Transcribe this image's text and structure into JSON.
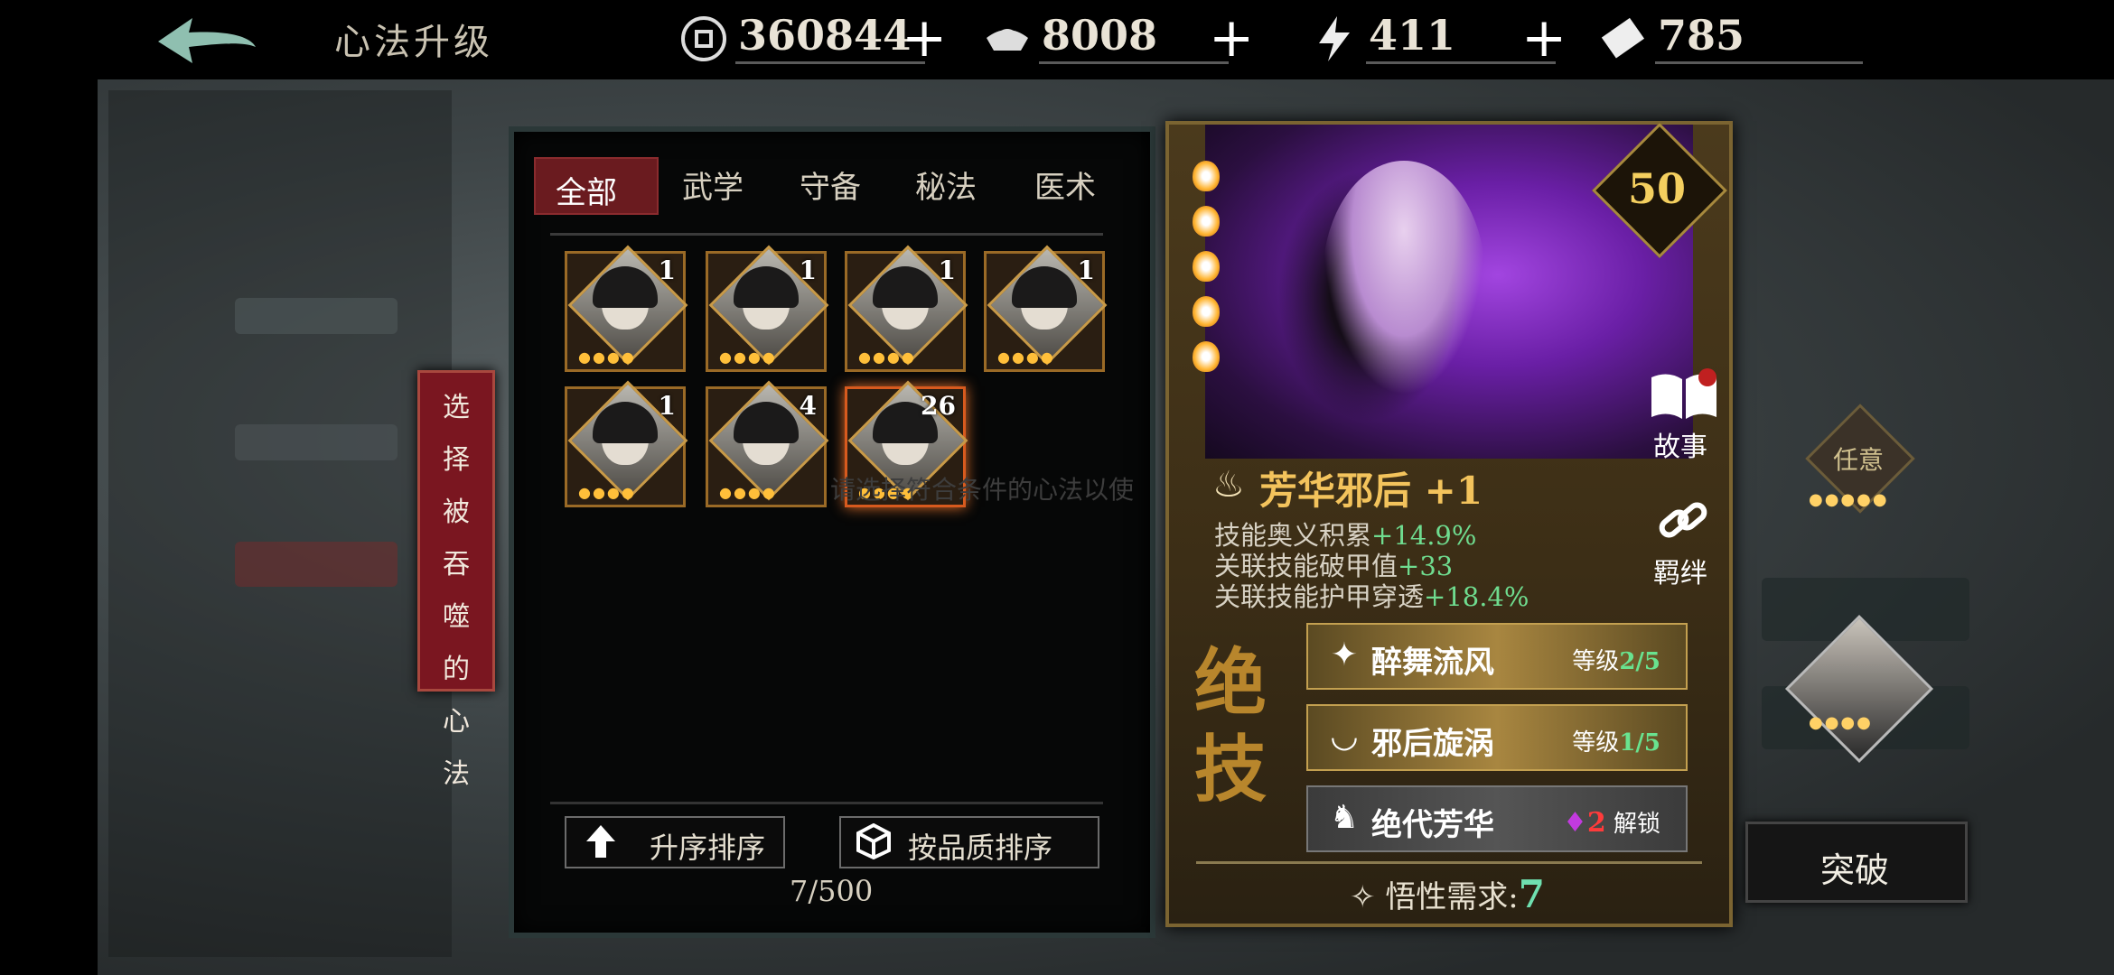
{
  "header": {
    "title": "心法升级",
    "resources": [
      {
        "icon": "coin-icon",
        "value": "360844"
      },
      {
        "icon": "silver-ingot-icon",
        "value": "8008"
      },
      {
        "icon": "lightning-icon",
        "value": "411"
      },
      {
        "icon": "ticket-icon",
        "value": "785"
      }
    ],
    "plus": "+"
  },
  "select_tag": [
    "选",
    "择",
    "被",
    "吞",
    "噬",
    "的",
    "心",
    "法"
  ],
  "tabs": [
    "全部",
    "武学",
    "守备",
    "秘法",
    "医术"
  ],
  "cards": [
    {
      "count": "1"
    },
    {
      "count": "1"
    },
    {
      "count": "1"
    },
    {
      "count": "1"
    },
    {
      "count": "1"
    },
    {
      "count": "4"
    },
    {
      "count": "26",
      "selected": true
    }
  ],
  "hint": "请选择符合条件的心法以使",
  "sort": {
    "asc": "升序排序",
    "quality": "按品质排序"
  },
  "inventory_count": "7/500",
  "detail": {
    "level": "50",
    "name": "芳华邪后 +1",
    "stats": [
      {
        "label": "技能奥义积累",
        "value": "+14.9%"
      },
      {
        "label": "关联技能破甲值",
        "value": "+33"
      },
      {
        "label": "关联技能护甲穿透",
        "value": "+18.4%"
      }
    ],
    "story": "故事",
    "bond": "羁绊",
    "ultimate": "绝技",
    "skills": [
      {
        "name": "醉舞流风",
        "level_label": "等级",
        "level": "2/5"
      },
      {
        "name": "邪后旋涡",
        "level_label": "等级",
        "level": "1/5"
      },
      {
        "name": "绝代芳华",
        "unlock_count": "2",
        "unlock_label": "解锁"
      }
    ],
    "requirement_label": "悟性需求:",
    "requirement": "7"
  },
  "right": {
    "any_label": "任意",
    "breakthrough": "突破"
  },
  "colors": {
    "accent_gold": "#f3c35c",
    "tab_active": "#6a1b1f",
    "stat_green": "#6fdc8f"
  }
}
